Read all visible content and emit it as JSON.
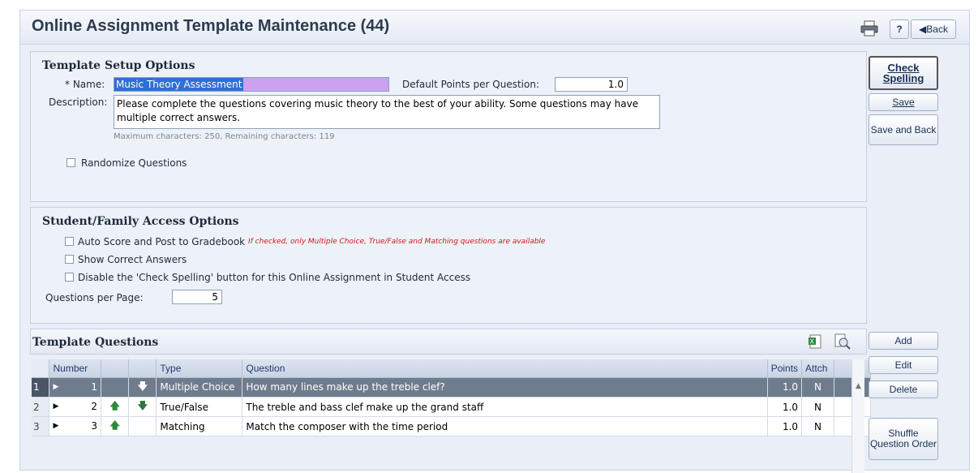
{
  "header": {
    "title": "Online Assignment Template Maintenance (44)",
    "print_icon": "printer-icon",
    "help_label": "?",
    "back_label": "◀Back"
  },
  "setup": {
    "title": "Template Setup Options",
    "name_label": "* Name:",
    "name_value": "Music Theory Assessment",
    "default_points_label": "Default Points per Question:",
    "default_points_value": "1.0",
    "description_label": "Description:",
    "description_value": "Please complete the questions covering music theory to the best of your ability.  Some questions may have multiple correct answers.",
    "char_info": "Maximum characters: 250, Remaining characters: 119",
    "randomize_label": "Randomize Questions"
  },
  "student": {
    "title": "Student/Family Access Options",
    "auto_score_label": "Auto Score and Post to Gradebook",
    "auto_score_note": "If checked, only Multiple Choice, True/False and Matching questions are available",
    "show_correct_label": "Show Correct Answers",
    "disable_spell_label": "Disable the 'Check Spelling' button for this Online Assignment in Student Access",
    "per_page_label": "Questions per Page:",
    "per_page_value": "5"
  },
  "questions": {
    "title": "Template Questions",
    "columns": {
      "number": "Number",
      "type": "Type",
      "question": "Question",
      "points": "Points",
      "attch": "Attch"
    },
    "rows": [
      {
        "row": "1",
        "number": "1",
        "up": "",
        "down": "🡇",
        "type": "Multiple Choice",
        "question": "How many lines make up the treble clef?",
        "points": "1.0",
        "attch": "N"
      },
      {
        "row": "2",
        "number": "2",
        "up": "🡅",
        "down": "🡇",
        "type": "True/False",
        "question": "The treble and bass clef make up the grand staff",
        "points": "1.0",
        "attch": "N"
      },
      {
        "row": "3",
        "number": "3",
        "up": "🡅",
        "down": "",
        "type": "Matching",
        "question": "Match the composer with the time period",
        "points": "1.0",
        "attch": "N"
      }
    ]
  },
  "side_buttons": {
    "check_spelling": "Check Spelling",
    "save": "Save",
    "save_and_back": "Save and Back",
    "add": "Add",
    "edit": "Edit",
    "delete": "Delete",
    "shuffle": "Shuffle Question Order"
  }
}
